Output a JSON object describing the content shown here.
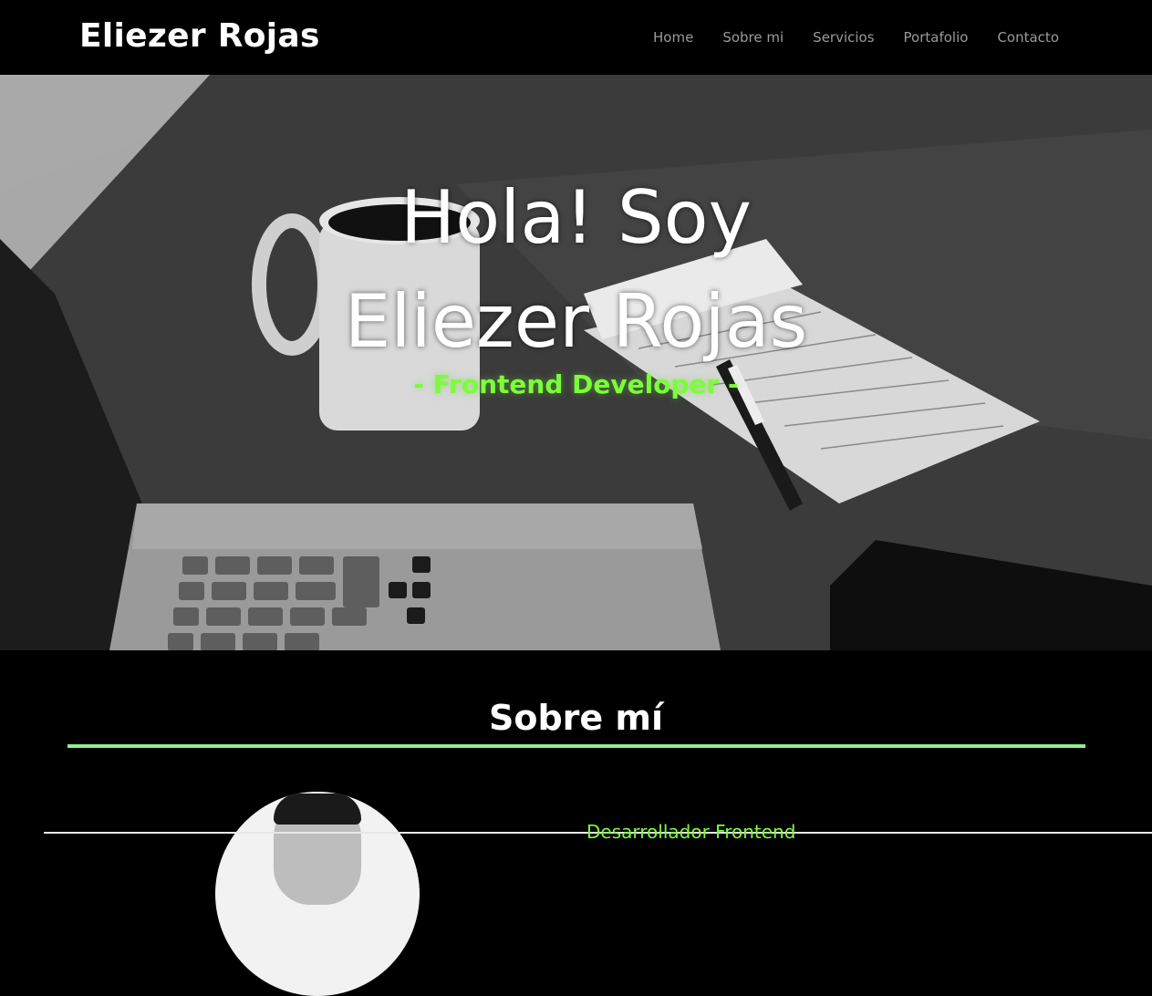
{
  "navbar": {
    "brand": "Eliezer Rojas",
    "links": [
      "Home",
      "Sobre mi",
      "Servicios",
      "Portafolio",
      "Contacto"
    ]
  },
  "hero": {
    "title_line1": "Hola! Soy",
    "title_line2": "Eliezer Rojas",
    "subtitle": "- Frontend Developer -"
  },
  "about": {
    "title": "Sobre mí",
    "role": "Desarrollador Frontend"
  },
  "colors": {
    "accent": "#7CFC3A",
    "rule": "#90EE90",
    "background": "#000000"
  }
}
